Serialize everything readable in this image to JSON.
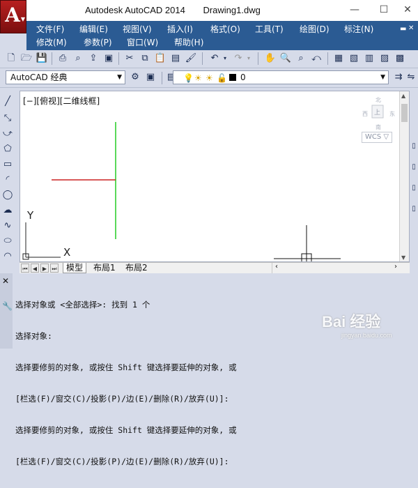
{
  "app": {
    "title": "Autodesk AutoCAD 2014",
    "document": "Drawing1.dwg",
    "logo_letter": "A"
  },
  "window_controls": {
    "minimize": "—",
    "maximize": "☐",
    "close": "✕"
  },
  "menu": {
    "row1": [
      "文件(F)",
      "编辑(E)",
      "视图(V)",
      "插入(I)",
      "格式(O)",
      "工具(T)",
      "绘图(D)",
      "标注(N)"
    ],
    "row2": [
      "修改(M)",
      "参数(P)",
      "窗口(W)",
      "帮助(H)"
    ]
  },
  "toolbar": {
    "workspace": "AutoCAD 经典",
    "layer_current": "0"
  },
  "viewport": {
    "label": "[−][俯视][二维线框]",
    "wcs": "WCS ▽",
    "cube_face": "上"
  },
  "layout_tabs": [
    "模型",
    "布局1",
    "布局2"
  ],
  "command_line": {
    "lines": [
      "选择对象或 <全部选择>: 找到 1 个",
      "选择对象:",
      "选择要修剪的对象, 或按住 Shift 键选择要延伸的对象, 或",
      "[栏选(F)/窗交(C)/投影(P)/边(E)/删除(R)/放弃(U)]:",
      "选择要修剪的对象, 或按住 Shift 键选择要延伸的对象, 或",
      "[栏选(F)/窗交(C)/投影(P)/边(E)/删除(R)/放弃(U)]:"
    ]
  },
  "watermark": {
    "main": "Bai 经验",
    "sub": "jingyan.baidu.com"
  },
  "colors": {
    "menubar": "#2b5b93",
    "line_green": "#22cc22",
    "line_red": "#cc2222",
    "chrome": "#d6dbe9"
  }
}
